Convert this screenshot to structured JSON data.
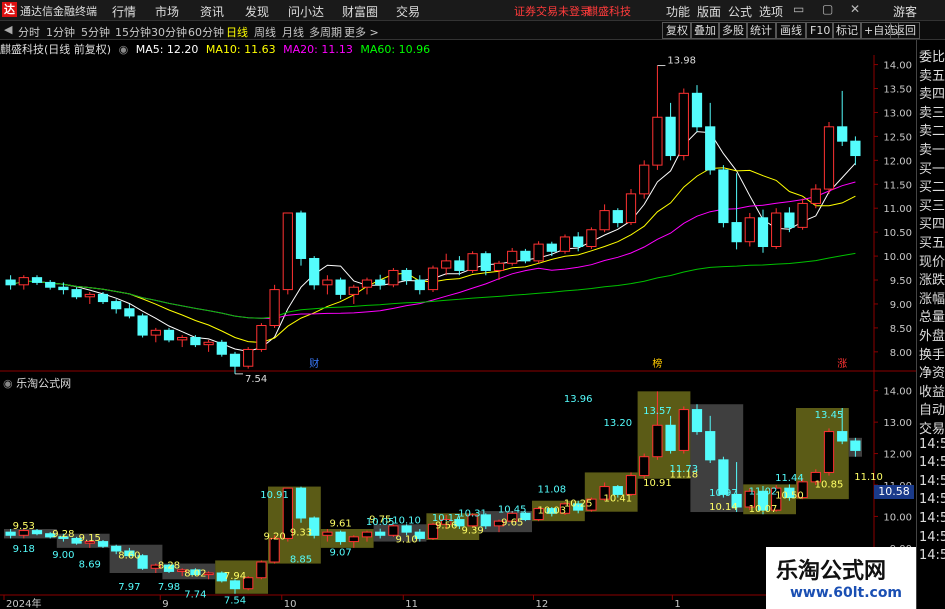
{
  "titlebar": {
    "logo": "达",
    "app": "通达信金融终端",
    "menus": [
      "行情",
      "市场",
      "资讯",
      "发现",
      "问小达",
      "财富圈",
      "交易"
    ],
    "alert": "证券交易未登录",
    "stock": "麒盛科技",
    "right_menus": [
      "功能",
      "版面",
      "公式",
      "选项"
    ],
    "guest": "游客"
  },
  "periodbar": {
    "periods": [
      "分时",
      "1分钟",
      "5分钟",
      "15分钟",
      "30分钟",
      "60分钟",
      "日线",
      "周线",
      "月线",
      "多周期",
      "更多 >"
    ],
    "active": "日线",
    "tools": [
      "复权",
      "叠加",
      "多股",
      "统计",
      "画线",
      "F10",
      "标记",
      "+自选",
      "返回"
    ]
  },
  "ma": {
    "title": "麒盛科技(日线 前复权)",
    "items": [
      {
        "label": "MA5: 12.20",
        "color": "#ffffff"
      },
      {
        "label": "MA10: 11.63",
        "color": "#ffff00"
      },
      {
        "label": "MA20: 11.13",
        "color": "#ff00ff"
      },
      {
        "label": "MA60: 10.96",
        "color": "#00ff00"
      }
    ]
  },
  "panel2": {
    "title": "乐淘公式网"
  },
  "sidebar": [
    "委比",
    "卖五",
    "卖四",
    "卖三",
    "卖二",
    "卖一",
    "买一",
    "买二",
    "买三",
    "买四",
    "买五",
    "现价",
    "涨跌",
    "涨幅",
    "总量",
    "外盘",
    "换手",
    "净资",
    "收益",
    "自动",
    "交易",
    "14:56",
    "14:56",
    "14:56",
    "14:56",
    "14:56",
    "14:56",
    "14:56"
  ],
  "selected_price": "10.58",
  "watermark": {
    "t1": "乐淘公式网",
    "t2": "www.60lt.com"
  },
  "chart_data": {
    "type": "candlestick",
    "upper": {
      "yticks": [
        "14.00",
        "13.50",
        "13.00",
        "12.50",
        "12.00",
        "11.50",
        "11.00",
        "10.50",
        "10.00",
        "9.50",
        "9.00",
        "8.50",
        "8.00"
      ],
      "ymin": 7.6,
      "ymax": 14.2,
      "markers": [
        {
          "label": "13.98"
        },
        {
          "label": "7.54"
        }
      ],
      "events": [
        {
          "label": "财",
          "color": "#3a7bff"
        },
        {
          "label": "榜",
          "color": "#ffcc00"
        },
        {
          "label": "涨",
          "color": "#ff3333"
        }
      ],
      "ohlc": [
        [
          9.5,
          9.6,
          9.3,
          9.4
        ],
        [
          9.4,
          9.6,
          9.3,
          9.55
        ],
        [
          9.55,
          9.6,
          9.4,
          9.45
        ],
        [
          9.45,
          9.5,
          9.3,
          9.35
        ],
        [
          9.35,
          9.45,
          9.2,
          9.3
        ],
        [
          9.3,
          9.35,
          9.1,
          9.15
        ],
        [
          9.15,
          9.25,
          9.0,
          9.2
        ],
        [
          9.2,
          9.25,
          9.0,
          9.05
        ],
        [
          9.05,
          9.1,
          8.8,
          8.9
        ],
        [
          8.9,
          9.0,
          8.7,
          8.75
        ],
        [
          8.75,
          8.8,
          8.3,
          8.35
        ],
        [
          8.35,
          8.5,
          8.2,
          8.45
        ],
        [
          8.45,
          8.5,
          8.2,
          8.25
        ],
        [
          8.25,
          8.35,
          8.1,
          8.3
        ],
        [
          8.3,
          8.35,
          8.1,
          8.15
        ],
        [
          8.15,
          8.25,
          8.0,
          8.2
        ],
        [
          8.2,
          8.25,
          7.9,
          7.95
        ],
        [
          7.95,
          8.0,
          7.54,
          7.7
        ],
        [
          7.7,
          8.1,
          7.65,
          8.05
        ],
        [
          8.05,
          8.6,
          8.0,
          8.55
        ],
        [
          8.55,
          9.4,
          8.5,
          9.3
        ],
        [
          9.3,
          10.91,
          9.2,
          10.9
        ],
        [
          10.9,
          10.95,
          9.8,
          9.95
        ],
        [
          9.95,
          10.0,
          9.3,
          9.4
        ],
        [
          9.4,
          9.6,
          9.2,
          9.5
        ],
        [
          9.5,
          9.55,
          9.1,
          9.2
        ],
        [
          9.2,
          9.4,
          9.0,
          9.35
        ],
        [
          9.35,
          9.55,
          9.2,
          9.5
        ],
        [
          9.5,
          9.61,
          9.3,
          9.4
        ],
        [
          9.4,
          9.75,
          9.35,
          9.7
        ],
        [
          9.7,
          9.75,
          9.4,
          9.5
        ],
        [
          9.5,
          9.6,
          9.2,
          9.3
        ],
        [
          9.3,
          9.8,
          9.25,
          9.75
        ],
        [
          9.75,
          10.05,
          9.6,
          9.9
        ],
        [
          9.9,
          10.0,
          9.6,
          9.7
        ],
        [
          9.7,
          10.1,
          9.65,
          10.05
        ],
        [
          10.05,
          10.1,
          9.6,
          9.7
        ],
        [
          9.7,
          9.9,
          9.5,
          9.85
        ],
        [
          9.85,
          10.17,
          9.8,
          10.1
        ],
        [
          10.1,
          10.15,
          9.85,
          9.9
        ],
        [
          9.9,
          10.31,
          9.85,
          10.25
        ],
        [
          10.25,
          10.3,
          10.0,
          10.1
        ],
        [
          10.1,
          10.45,
          10.05,
          10.4
        ],
        [
          10.4,
          10.5,
          10.1,
          10.2
        ],
        [
          10.2,
          10.6,
          10.15,
          10.55
        ],
        [
          10.55,
          11.08,
          10.5,
          10.95
        ],
        [
          10.95,
          11.0,
          10.6,
          10.7
        ],
        [
          10.7,
          11.4,
          10.65,
          11.3
        ],
        [
          11.3,
          12.0,
          11.2,
          11.9
        ],
        [
          11.9,
          13.98,
          11.8,
          12.9
        ],
        [
          12.9,
          13.2,
          12.0,
          12.1
        ],
        [
          12.1,
          13.5,
          12.0,
          13.4
        ],
        [
          13.4,
          13.57,
          12.6,
          12.7
        ],
        [
          12.7,
          13.2,
          11.7,
          11.8
        ],
        [
          11.8,
          11.9,
          10.6,
          10.7
        ],
        [
          10.7,
          11.73,
          10.14,
          10.3
        ],
        [
          10.3,
          10.9,
          10.2,
          10.8
        ],
        [
          10.8,
          10.97,
          10.07,
          10.2
        ],
        [
          10.2,
          11.0,
          10.15,
          10.9
        ],
        [
          10.9,
          11.02,
          10.5,
          10.6
        ],
        [
          10.6,
          11.2,
          10.55,
          11.1
        ],
        [
          11.1,
          11.5,
          11.0,
          11.4
        ],
        [
          11.4,
          12.8,
          11.3,
          12.7
        ],
        [
          12.7,
          13.45,
          12.3,
          12.4
        ],
        [
          12.4,
          12.5,
          11.9,
          12.1
        ]
      ]
    },
    "lower": {
      "yticks": [
        "14.00",
        "13.00",
        "12.00",
        "11.00",
        "10.00",
        "9.00",
        "8.00"
      ],
      "ymin": 7.5,
      "ymax": 14.5,
      "labels": [
        "9.53",
        "9.18",
        "9.28",
        "9.00",
        "9.15",
        "8.69",
        "8.60",
        "7.97",
        "8.28",
        "7.98",
        "8.02",
        "7.74",
        "7.94",
        "7.54",
        "9.20",
        "10.91",
        "9.33",
        "8.85",
        "9.61",
        "9.07",
        "9.75",
        "10.05",
        "9.10",
        "10.10",
        "9.56",
        "10.17",
        "9.39",
        "10.31",
        "9.65",
        "10.45",
        "10.03",
        "11.08",
        "10.25",
        "13.96",
        "10.41",
        "13.20",
        "10.91",
        "13.57",
        "11.18",
        "11.73",
        "10.14",
        "10.97",
        "10.07",
        "11.02",
        "10.50",
        "11.44",
        "10.85",
        "13.45",
        "11.10"
      ]
    },
    "xlabels": [
      "2024年",
      "9",
      "10",
      "11",
      "12",
      "1"
    ]
  }
}
